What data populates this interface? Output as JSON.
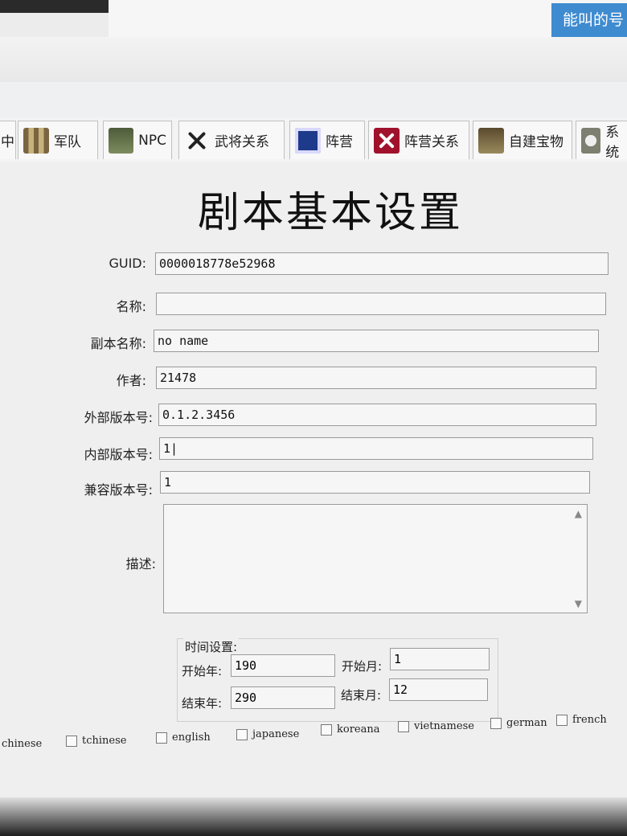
{
  "top": {
    "bg_button_text": "能叫的号"
  },
  "tabs": [
    {
      "label": "中",
      "icon": "unknown-icon"
    },
    {
      "label": "军队",
      "icon": "army-icon"
    },
    {
      "label": "NPC",
      "icon": "npc-icon"
    },
    {
      "label": "武将关系",
      "icon": "crossed-swords-icon"
    },
    {
      "label": "阵营",
      "icon": "shield-icon"
    },
    {
      "label": "阵营关系",
      "icon": "faction-swords-icon"
    },
    {
      "label": "自建宝物",
      "icon": "treasure-icon"
    },
    {
      "label": "系统",
      "icon": "system-icon"
    }
  ],
  "page": {
    "title": "剧本基本设置"
  },
  "form": {
    "guid": {
      "label": "GUID:",
      "value": "0000018778e52968"
    },
    "name": {
      "label": "名称:",
      "value": ""
    },
    "script_name": {
      "label": "副本名称:",
      "value": "no name"
    },
    "author": {
      "label": "作者:",
      "value": "21478"
    },
    "ext_version": {
      "label": "外部版本号:",
      "value": "0.1.2.3456"
    },
    "int_version": {
      "label": "内部版本号:",
      "value": "1|"
    },
    "compat_version": {
      "label": "兼容版本号:",
      "value": "1"
    },
    "description": {
      "label": "描述:",
      "value": ""
    }
  },
  "time": {
    "title": "时间设置:",
    "start_year": {
      "label": "开始年:",
      "value": "190"
    },
    "start_month": {
      "label": "开始月:",
      "value": "1"
    },
    "end_year": {
      "label": "结束年:",
      "value": "290"
    },
    "end_month": {
      "label": "结束月:",
      "value": "12"
    }
  },
  "languages": [
    "chinese",
    "tchinese",
    "english",
    "japanese",
    "koreana",
    "vietnamese",
    "german",
    "french"
  ]
}
